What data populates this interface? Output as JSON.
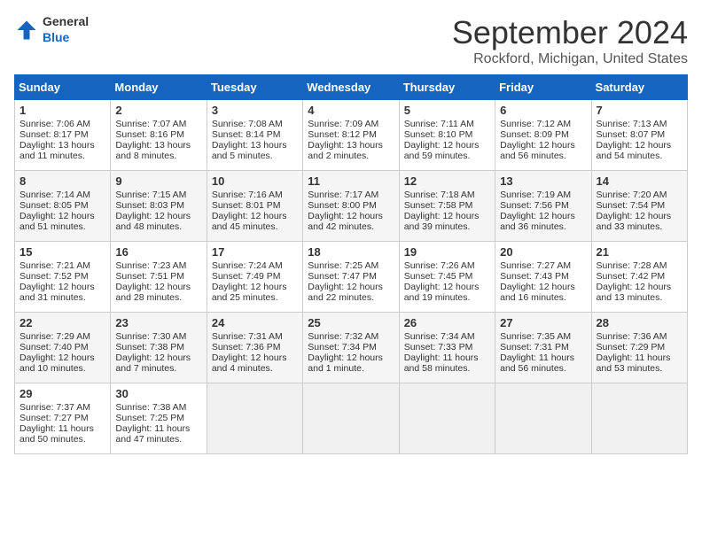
{
  "header": {
    "logo_general": "General",
    "logo_blue": "Blue",
    "month": "September 2024",
    "location": "Rockford, Michigan, United States"
  },
  "days_of_week": [
    "Sunday",
    "Monday",
    "Tuesday",
    "Wednesday",
    "Thursday",
    "Friday",
    "Saturday"
  ],
  "weeks": [
    [
      {
        "day": "1",
        "sunrise": "Sunrise: 7:06 AM",
        "sunset": "Sunset: 8:17 PM",
        "daylight": "Daylight: 13 hours and 11 minutes."
      },
      {
        "day": "2",
        "sunrise": "Sunrise: 7:07 AM",
        "sunset": "Sunset: 8:16 PM",
        "daylight": "Daylight: 13 hours and 8 minutes."
      },
      {
        "day": "3",
        "sunrise": "Sunrise: 7:08 AM",
        "sunset": "Sunset: 8:14 PM",
        "daylight": "Daylight: 13 hours and 5 minutes."
      },
      {
        "day": "4",
        "sunrise": "Sunrise: 7:09 AM",
        "sunset": "Sunset: 8:12 PM",
        "daylight": "Daylight: 13 hours and 2 minutes."
      },
      {
        "day": "5",
        "sunrise": "Sunrise: 7:11 AM",
        "sunset": "Sunset: 8:10 PM",
        "daylight": "Daylight: 12 hours and 59 minutes."
      },
      {
        "day": "6",
        "sunrise": "Sunrise: 7:12 AM",
        "sunset": "Sunset: 8:09 PM",
        "daylight": "Daylight: 12 hours and 56 minutes."
      },
      {
        "day": "7",
        "sunrise": "Sunrise: 7:13 AM",
        "sunset": "Sunset: 8:07 PM",
        "daylight": "Daylight: 12 hours and 54 minutes."
      }
    ],
    [
      {
        "day": "8",
        "sunrise": "Sunrise: 7:14 AM",
        "sunset": "Sunset: 8:05 PM",
        "daylight": "Daylight: 12 hours and 51 minutes."
      },
      {
        "day": "9",
        "sunrise": "Sunrise: 7:15 AM",
        "sunset": "Sunset: 8:03 PM",
        "daylight": "Daylight: 12 hours and 48 minutes."
      },
      {
        "day": "10",
        "sunrise": "Sunrise: 7:16 AM",
        "sunset": "Sunset: 8:01 PM",
        "daylight": "Daylight: 12 hours and 45 minutes."
      },
      {
        "day": "11",
        "sunrise": "Sunrise: 7:17 AM",
        "sunset": "Sunset: 8:00 PM",
        "daylight": "Daylight: 12 hours and 42 minutes."
      },
      {
        "day": "12",
        "sunrise": "Sunrise: 7:18 AM",
        "sunset": "Sunset: 7:58 PM",
        "daylight": "Daylight: 12 hours and 39 minutes."
      },
      {
        "day": "13",
        "sunrise": "Sunrise: 7:19 AM",
        "sunset": "Sunset: 7:56 PM",
        "daylight": "Daylight: 12 hours and 36 minutes."
      },
      {
        "day": "14",
        "sunrise": "Sunrise: 7:20 AM",
        "sunset": "Sunset: 7:54 PM",
        "daylight": "Daylight: 12 hours and 33 minutes."
      }
    ],
    [
      {
        "day": "15",
        "sunrise": "Sunrise: 7:21 AM",
        "sunset": "Sunset: 7:52 PM",
        "daylight": "Daylight: 12 hours and 31 minutes."
      },
      {
        "day": "16",
        "sunrise": "Sunrise: 7:23 AM",
        "sunset": "Sunset: 7:51 PM",
        "daylight": "Daylight: 12 hours and 28 minutes."
      },
      {
        "day": "17",
        "sunrise": "Sunrise: 7:24 AM",
        "sunset": "Sunset: 7:49 PM",
        "daylight": "Daylight: 12 hours and 25 minutes."
      },
      {
        "day": "18",
        "sunrise": "Sunrise: 7:25 AM",
        "sunset": "Sunset: 7:47 PM",
        "daylight": "Daylight: 12 hours and 22 minutes."
      },
      {
        "day": "19",
        "sunrise": "Sunrise: 7:26 AM",
        "sunset": "Sunset: 7:45 PM",
        "daylight": "Daylight: 12 hours and 19 minutes."
      },
      {
        "day": "20",
        "sunrise": "Sunrise: 7:27 AM",
        "sunset": "Sunset: 7:43 PM",
        "daylight": "Daylight: 12 hours and 16 minutes."
      },
      {
        "day": "21",
        "sunrise": "Sunrise: 7:28 AM",
        "sunset": "Sunset: 7:42 PM",
        "daylight": "Daylight: 12 hours and 13 minutes."
      }
    ],
    [
      {
        "day": "22",
        "sunrise": "Sunrise: 7:29 AM",
        "sunset": "Sunset: 7:40 PM",
        "daylight": "Daylight: 12 hours and 10 minutes."
      },
      {
        "day": "23",
        "sunrise": "Sunrise: 7:30 AM",
        "sunset": "Sunset: 7:38 PM",
        "daylight": "Daylight: 12 hours and 7 minutes."
      },
      {
        "day": "24",
        "sunrise": "Sunrise: 7:31 AM",
        "sunset": "Sunset: 7:36 PM",
        "daylight": "Daylight: 12 hours and 4 minutes."
      },
      {
        "day": "25",
        "sunrise": "Sunrise: 7:32 AM",
        "sunset": "Sunset: 7:34 PM",
        "daylight": "Daylight: 12 hours and 1 minute."
      },
      {
        "day": "26",
        "sunrise": "Sunrise: 7:34 AM",
        "sunset": "Sunset: 7:33 PM",
        "daylight": "Daylight: 11 hours and 58 minutes."
      },
      {
        "day": "27",
        "sunrise": "Sunrise: 7:35 AM",
        "sunset": "Sunset: 7:31 PM",
        "daylight": "Daylight: 11 hours and 56 minutes."
      },
      {
        "day": "28",
        "sunrise": "Sunrise: 7:36 AM",
        "sunset": "Sunset: 7:29 PM",
        "daylight": "Daylight: 11 hours and 53 minutes."
      }
    ],
    [
      {
        "day": "29",
        "sunrise": "Sunrise: 7:37 AM",
        "sunset": "Sunset: 7:27 PM",
        "daylight": "Daylight: 11 hours and 50 minutes."
      },
      {
        "day": "30",
        "sunrise": "Sunrise: 7:38 AM",
        "sunset": "Sunset: 7:25 PM",
        "daylight": "Daylight: 11 hours and 47 minutes."
      },
      {
        "day": "",
        "sunrise": "",
        "sunset": "",
        "daylight": ""
      },
      {
        "day": "",
        "sunrise": "",
        "sunset": "",
        "daylight": ""
      },
      {
        "day": "",
        "sunrise": "",
        "sunset": "",
        "daylight": ""
      },
      {
        "day": "",
        "sunrise": "",
        "sunset": "",
        "daylight": ""
      },
      {
        "day": "",
        "sunrise": "",
        "sunset": "",
        "daylight": ""
      }
    ]
  ]
}
